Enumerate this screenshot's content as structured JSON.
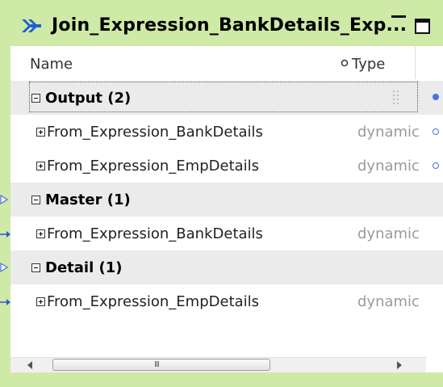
{
  "window": {
    "title": "Join_Expression_BankDetails_Exp...",
    "accent_color": "#cfe9a6"
  },
  "columns": {
    "name": "Name",
    "type": "Type"
  },
  "groups": [
    {
      "label": "Output (2)",
      "ports": [
        {
          "name": "From_Expression_BankDetails",
          "type": "dynamic"
        },
        {
          "name": "From_Expression_EmpDetails",
          "type": "dynamic"
        }
      ]
    },
    {
      "label": "Master (1)",
      "ports": [
        {
          "name": "From_Expression_BankDetails",
          "type": "dynamic"
        }
      ]
    },
    {
      "label": "Detail (1)",
      "ports": [
        {
          "name": "From_Expression_EmpDetails",
          "type": "dynamic"
        }
      ]
    }
  ],
  "scrollbar": {
    "grip": "III"
  }
}
